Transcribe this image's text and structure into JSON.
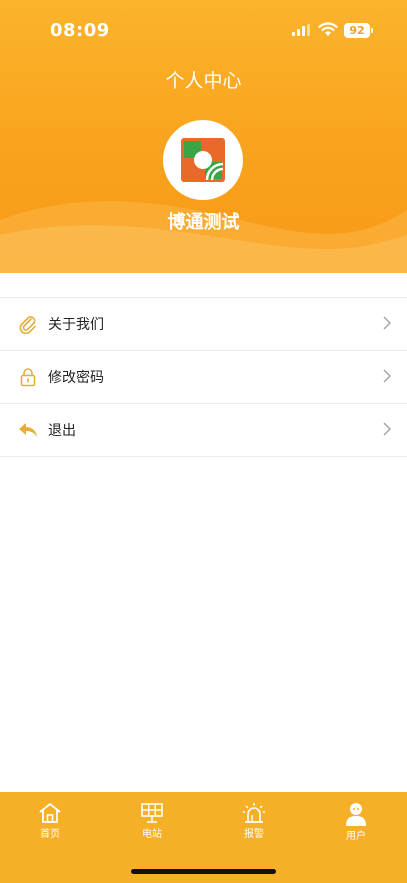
{
  "status": {
    "time": "08:09",
    "battery": "92"
  },
  "header": {
    "title": "个人中心",
    "username": "博通测试"
  },
  "menu": [
    {
      "label": "关于我们",
      "icon": "paperclip-icon"
    },
    {
      "label": "修改密码",
      "icon": "lock-icon"
    },
    {
      "label": "退出",
      "icon": "reply-icon"
    }
  ],
  "tabs": [
    {
      "label": "首页",
      "icon": "home-icon"
    },
    {
      "label": "电站",
      "icon": "solar-panel-icon"
    },
    {
      "label": "报警",
      "icon": "alarm-icon"
    },
    {
      "label": "用户",
      "icon": "user-icon",
      "active": true
    }
  ],
  "colors": {
    "accent": "#f5b027",
    "header": "#f9a11c"
  }
}
